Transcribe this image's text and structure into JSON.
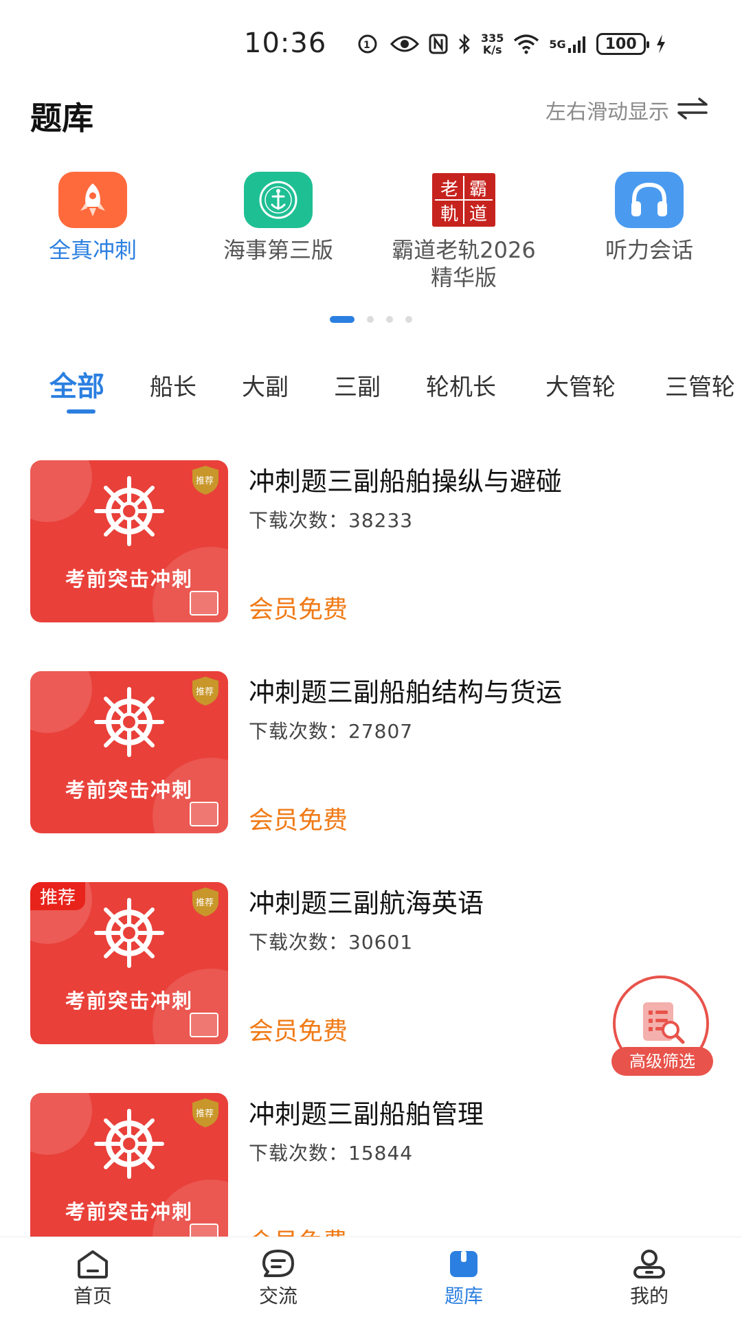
{
  "status_bar": {
    "time": "10:36",
    "net_speed_value": "335",
    "net_speed_unit": "K/s",
    "network": "5G",
    "battery": "100"
  },
  "header": {
    "title": "题库",
    "swipe_hint": "左右滑动显示"
  },
  "featured": [
    {
      "label": "全真冲刺",
      "icon": "rocket-icon",
      "active": true
    },
    {
      "label": "海事第三版",
      "icon": "maritime-emblem-icon",
      "active": false
    },
    {
      "label": "霸道老轨2026精华版",
      "icon": "seal-logo-icon",
      "active": false
    },
    {
      "label": "听力会话",
      "icon": "headphones-icon",
      "active": false
    }
  ],
  "featured_labels": {
    "item0": "全真冲刺",
    "item1": "海事第三版",
    "item2_line1": "霸道老轨2026",
    "item2_line2": "精华版",
    "item3": "听力会话"
  },
  "seal_chars": {
    "c1": "老",
    "c2": "霸",
    "c3": "軌",
    "c4": "道"
  },
  "pager": {
    "pages": 4,
    "current": 1
  },
  "tabs": {
    "t0": "全部",
    "t1": "船长",
    "t2": "大副",
    "t3": "三副",
    "t4": "轮机长",
    "t5": "大管轮",
    "t6": "三管轮"
  },
  "thumb": {
    "caption": "考前突击冲刺",
    "badge": "推荐",
    "tag": "推荐"
  },
  "items": [
    {
      "title": "冲刺题三副船舶操纵与避碰",
      "downloads": "下载次数：38233",
      "price": "会员免费"
    },
    {
      "title": "冲刺题三副船舶结构与货运",
      "downloads": "下载次数：27807",
      "price": "会员免费"
    },
    {
      "title": "冲刺题三副航海英语",
      "downloads": "下载次数：30601",
      "price": "会员免费",
      "tag": "推荐"
    },
    {
      "title": "冲刺题三副船舶管理",
      "downloads": "下载次数：15844",
      "price": "会员免费"
    }
  ],
  "filter_button": {
    "label": "高级筛选"
  },
  "bottom_nav": {
    "home": "首页",
    "community": "交流",
    "question_bank": "题库",
    "mine": "我的"
  },
  "colors": {
    "accent_blue": "#2b7fe0",
    "price_orange": "#f07a16",
    "thumb_red": "#e9403a",
    "filter_red": "#e8534b"
  }
}
